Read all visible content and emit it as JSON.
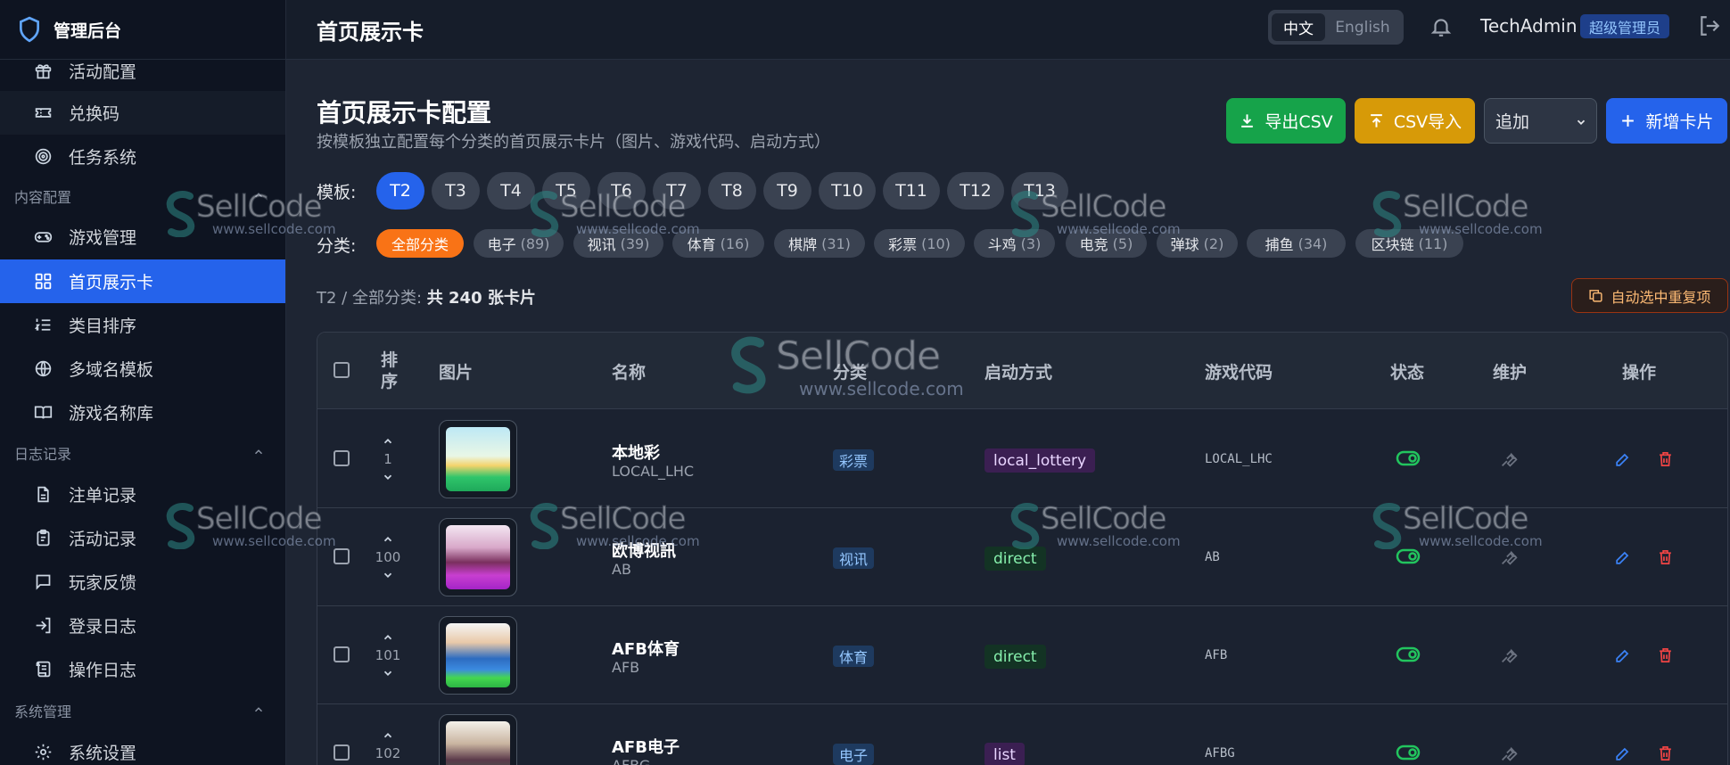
{
  "brand": {
    "title": "管理后台"
  },
  "sidebar": {
    "items_top": [
      {
        "label": "活动配置",
        "icon": "gift-icon"
      },
      {
        "label": "兑换码",
        "icon": "ticket-icon"
      },
      {
        "label": "任务系统",
        "icon": "target-icon"
      }
    ],
    "sections": [
      {
        "title": "内容配置",
        "items": [
          {
            "label": "游戏管理",
            "icon": "gamepad-icon"
          },
          {
            "label": "首页展示卡",
            "icon": "grid-icon",
            "active": true
          },
          {
            "label": "类目排序",
            "icon": "list-ordered-icon"
          },
          {
            "label": "多域名模板",
            "icon": "globe-icon"
          },
          {
            "label": "游戏名称库",
            "icon": "book-icon"
          }
        ]
      },
      {
        "title": "日志记录",
        "items": [
          {
            "label": "注单记录",
            "icon": "file-text-icon"
          },
          {
            "label": "活动记录",
            "icon": "clipboard-icon"
          },
          {
            "label": "玩家反馈",
            "icon": "message-icon"
          },
          {
            "label": "登录日志",
            "icon": "login-icon"
          },
          {
            "label": "操作日志",
            "icon": "scroll-icon"
          }
        ]
      },
      {
        "title": "系统管理",
        "items": [
          {
            "label": "系统设置",
            "icon": "gear-icon"
          }
        ]
      }
    ]
  },
  "topbar": {
    "title": "首页展示卡",
    "lang_zh": "中文",
    "lang_en": "English",
    "username": "TechAdmin",
    "role": "超级管理员"
  },
  "page": {
    "title": "首页展示卡配置",
    "subtitle": "按模板独立配置每个分类的首页展示卡片（图片、游戏代码、启动方式）"
  },
  "actions": {
    "export": "导出CSV",
    "import": "CSV导入",
    "mode": "追加",
    "add": "新增卡片"
  },
  "filters": {
    "template_label": "模板:",
    "templates": [
      "T2",
      "T3",
      "T4",
      "T5",
      "T6",
      "T7",
      "T8",
      "T9",
      "T10",
      "T11",
      "T12",
      "T13"
    ],
    "selected_template": "T2",
    "category_label": "分类:",
    "categories": [
      {
        "label": "全部分类",
        "count": ""
      },
      {
        "label": "电子",
        "count": "(89)"
      },
      {
        "label": "视讯",
        "count": "(39)"
      },
      {
        "label": "体育",
        "count": "(16)"
      },
      {
        "label": "棋牌",
        "count": "(31)"
      },
      {
        "label": "彩票",
        "count": "(10)"
      },
      {
        "label": "斗鸡",
        "count": "(3)"
      },
      {
        "label": "电竞",
        "count": "(5)"
      },
      {
        "label": "弹球",
        "count": "(2)"
      },
      {
        "label": "捕鱼",
        "count": "(34)"
      },
      {
        "label": "区块链",
        "count": "(11)"
      }
    ]
  },
  "summary": {
    "prefix": "T2 / 全部分类:",
    "bold": "共 240 张卡片"
  },
  "auto_select": "自动选中重复项",
  "table": {
    "headers": {
      "sort": "排序",
      "image": "图片",
      "name": "名称",
      "category": "分类",
      "launch": "启动方式",
      "game_code": "游戏代码",
      "status": "状态",
      "maintenance": "维护",
      "ops": "操作"
    },
    "rows": [
      {
        "sort": "1",
        "name": "本地彩",
        "code": "LOCAL_LHC",
        "category": "彩票",
        "launch": "local_lottery",
        "game_code": "LOCAL_LHC",
        "status": "enabled"
      },
      {
        "sort": "100",
        "name": "欧博视訊",
        "code": "AB",
        "category": "视讯",
        "launch": "direct",
        "game_code": "AB",
        "status": "enabled"
      },
      {
        "sort": "101",
        "name": "AFB体育",
        "code": "AFB",
        "category": "体育",
        "launch": "direct",
        "game_code": "AFB",
        "status": "enabled"
      },
      {
        "sort": "102",
        "name": "AFB电子",
        "code": "AFBG",
        "category": "电子",
        "launch": "list",
        "game_code": "AFBG",
        "status": "enabled"
      }
    ]
  },
  "watermark": {
    "brand": "SellCode",
    "url": "www.sellcode.com"
  },
  "colors": {
    "primary": "#2563eb",
    "export": "#16a34a",
    "import": "#d79a08",
    "active_category": "#f97316",
    "danger": "#ef4444",
    "success": "#22c55e"
  }
}
